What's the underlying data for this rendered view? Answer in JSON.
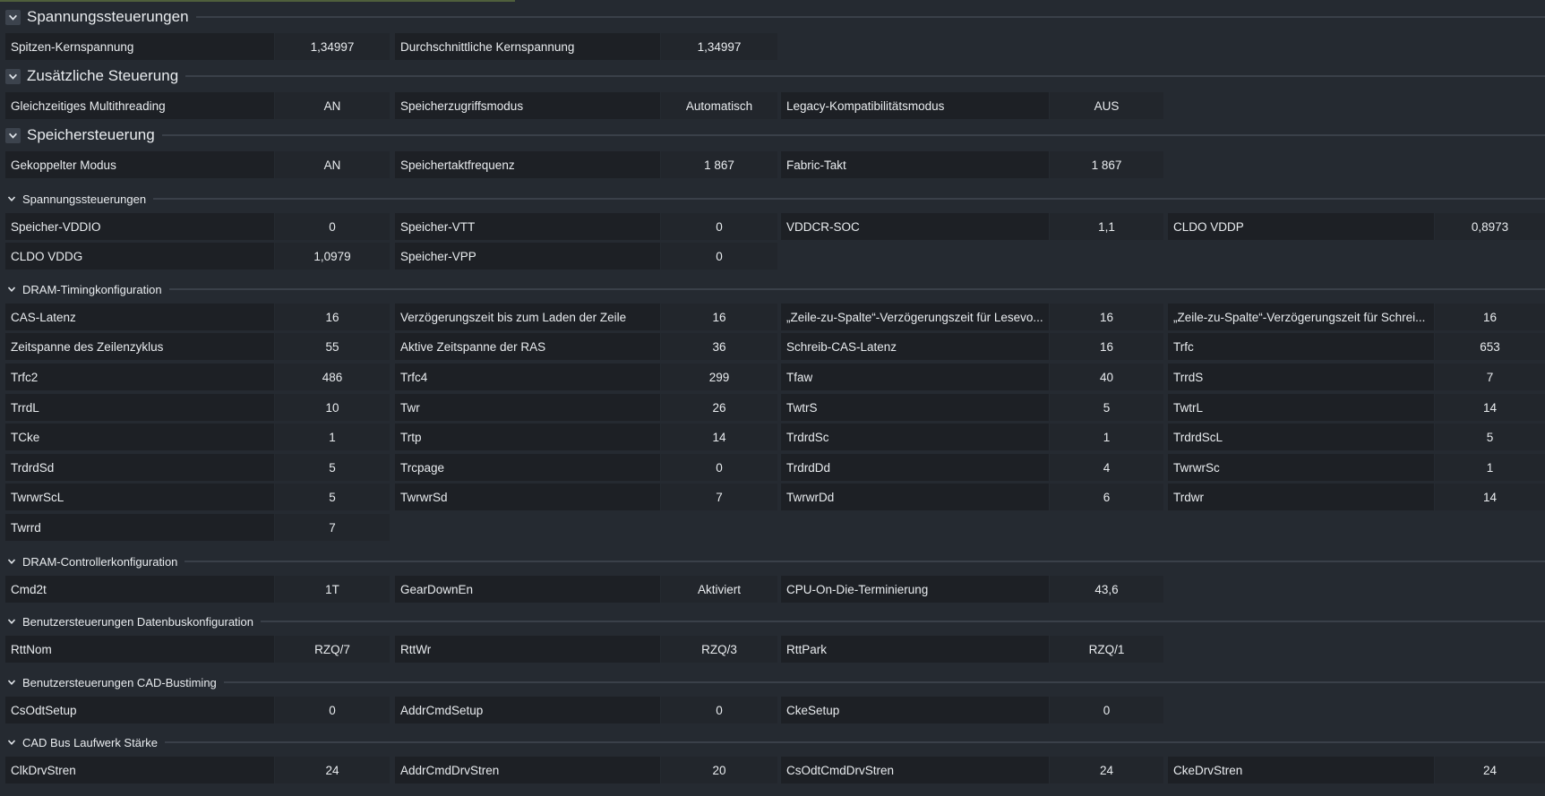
{
  "sections": [
    {
      "title": "Spannungssteuerungen",
      "size": "big",
      "rows": [
        [
          {
            "label": "Spitzen-Kernspannung",
            "value": "1,34997"
          },
          {
            "label": "Durchschnittliche Kernspannung",
            "value": "1,34997"
          }
        ]
      ]
    },
    {
      "title": "Zusätzliche Steuerung",
      "size": "big",
      "rows": [
        [
          {
            "label": "Gleichzeitiges Multithreading",
            "value": "AN"
          },
          {
            "label": "Speicherzugriffsmodus",
            "value": "Automatisch"
          },
          {
            "label": "Legacy-Kompatibilitätsmodus",
            "value": "AUS"
          }
        ]
      ]
    },
    {
      "title": "Speichersteuerung",
      "size": "big",
      "rows": [
        [
          {
            "label": "Gekoppelter Modus",
            "value": "AN"
          },
          {
            "label": "Speichertaktfrequenz",
            "value": "1 867"
          },
          {
            "label": "Fabric-Takt",
            "value": "1 867"
          }
        ]
      ]
    },
    {
      "title": "Spannungssteuerungen",
      "size": "small",
      "rows": [
        [
          {
            "label": "Speicher-VDDIO",
            "value": "0"
          },
          {
            "label": "Speicher-VTT",
            "value": "0"
          },
          {
            "label": "VDDCR-SOC",
            "value": "1,1"
          },
          {
            "label": "CLDO VDDP",
            "value": "0,8973"
          }
        ],
        [
          {
            "label": "CLDO VDDG",
            "value": "1,0979"
          },
          {
            "label": "Speicher-VPP",
            "value": "0"
          }
        ]
      ]
    },
    {
      "title": "DRAM-Timingkonfiguration",
      "size": "small",
      "rows": [
        [
          {
            "label": "CAS-Latenz",
            "value": "16"
          },
          {
            "label": "Verzögerungszeit bis zum Laden der Zeile",
            "value": "16"
          },
          {
            "label": "„Zeile-zu-Spalte“-Verzögerungszeit für Lesevo...",
            "value": "16"
          },
          {
            "label": "„Zeile-zu-Spalte“-Verzögerungszeit für Schrei...",
            "value": "16"
          }
        ],
        [
          {
            "label": "Zeitspanne des Zeilenzyklus",
            "value": "55"
          },
          {
            "label": "Aktive Zeitspanne der RAS",
            "value": "36"
          },
          {
            "label": "Schreib-CAS-Latenz",
            "value": "16"
          },
          {
            "label": "Trfc",
            "value": "653"
          }
        ],
        [
          {
            "label": "Trfc2",
            "value": "486"
          },
          {
            "label": "Trfc4",
            "value": "299"
          },
          {
            "label": "Tfaw",
            "value": "40"
          },
          {
            "label": "TrrdS",
            "value": "7"
          }
        ],
        [
          {
            "label": "TrrdL",
            "value": "10"
          },
          {
            "label": "Twr",
            "value": "26"
          },
          {
            "label": "TwtrS",
            "value": "5"
          },
          {
            "label": "TwtrL",
            "value": "14"
          }
        ],
        [
          {
            "label": "TCke",
            "value": "1"
          },
          {
            "label": "Trtp",
            "value": "14"
          },
          {
            "label": "TrdrdSc",
            "value": "1"
          },
          {
            "label": "TrdrdScL",
            "value": "5"
          }
        ],
        [
          {
            "label": "TrdrdSd",
            "value": "5"
          },
          {
            "label": "Trcpage",
            "value": "0"
          },
          {
            "label": "TrdrdDd",
            "value": "4"
          },
          {
            "label": "TwrwrSc",
            "value": "1"
          }
        ],
        [
          {
            "label": "TwrwrScL",
            "value": "5"
          },
          {
            "label": "TwrwrSd",
            "value": "7"
          },
          {
            "label": "TwrwrDd",
            "value": "6"
          },
          {
            "label": "Trdwr",
            "value": "14"
          }
        ],
        [
          {
            "label": "Twrrd",
            "value": "7"
          }
        ]
      ]
    },
    {
      "title": "DRAM-Controllerkonfiguration",
      "size": "small",
      "rows": [
        [
          {
            "label": "Cmd2t",
            "value": "1T"
          },
          {
            "label": "GearDownEn",
            "value": "Aktiviert"
          },
          {
            "label": "CPU-On-Die-Terminierung",
            "value": "43,6"
          }
        ]
      ]
    },
    {
      "title": "Benutzersteuerungen Datenbuskonfiguration",
      "size": "small",
      "rows": [
        [
          {
            "label": "RttNom",
            "value": "RZQ/7"
          },
          {
            "label": "RttWr",
            "value": "RZQ/3"
          },
          {
            "label": "RttPark",
            "value": "RZQ/1"
          }
        ]
      ]
    },
    {
      "title": "Benutzersteuerungen CAD-Bustiming",
      "size": "small",
      "rows": [
        [
          {
            "label": "CsOdtSetup",
            "value": "0"
          },
          {
            "label": "AddrCmdSetup",
            "value": "0"
          },
          {
            "label": "CkeSetup",
            "value": "0"
          }
        ]
      ]
    },
    {
      "title": "CAD Bus Laufwerk Stärke",
      "size": "small",
      "rows": [
        [
          {
            "label": "ClkDrvStren",
            "value": "24"
          },
          {
            "label": "AddrCmdDrvStren",
            "value": "20"
          },
          {
            "label": "CsOdtCmdDrvStren",
            "value": "24"
          },
          {
            "label": "CkeDrvStren",
            "value": "24"
          }
        ]
      ]
    }
  ]
}
